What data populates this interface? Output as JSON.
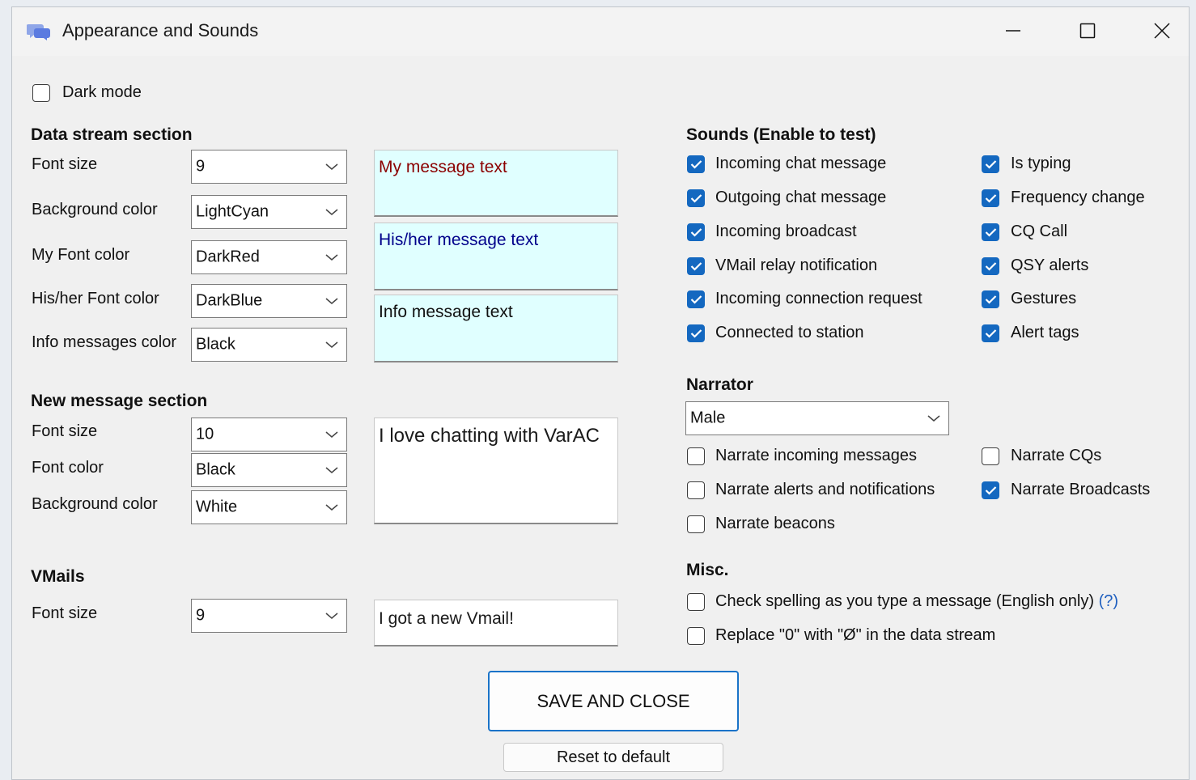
{
  "window": {
    "title": "Appearance and Sounds"
  },
  "dark_mode": {
    "label": "Dark mode",
    "checked": false
  },
  "data_stream": {
    "header": "Data stream section",
    "font_size": {
      "label": "Font size",
      "value": "9"
    },
    "background_color": {
      "label": "Background color",
      "value": "LightCyan"
    },
    "my_font_color": {
      "label": "My Font color",
      "value": "DarkRed"
    },
    "his_font_color": {
      "label": "His/her Font color",
      "value": "DarkBlue"
    },
    "info_color": {
      "label": "Info messages color",
      "value": "Black"
    },
    "preview_my": "My message text",
    "preview_his": "His/her message text",
    "preview_info": "Info message text",
    "colors": {
      "background": "#E0FFFF",
      "my": "#8B0000",
      "his": "#00008B",
      "info": "#000000"
    }
  },
  "new_message": {
    "header": "New message section",
    "font_size": {
      "label": "Font size",
      "value": "10"
    },
    "font_color": {
      "label": "Font color",
      "value": "Black"
    },
    "background_color": {
      "label": "Background color",
      "value": "White"
    },
    "preview": "I love chatting with VarAC"
  },
  "vmails": {
    "header": "VMails",
    "font_size": {
      "label": "Font size",
      "value": "9"
    },
    "preview": "I got a new Vmail!"
  },
  "sounds": {
    "header": "Sounds (Enable to test)",
    "left": [
      {
        "label": "Incoming chat message",
        "checked": true
      },
      {
        "label": "Outgoing chat message",
        "checked": true
      },
      {
        "label": "Incoming broadcast",
        "checked": true
      },
      {
        "label": "VMail relay notification",
        "checked": true
      },
      {
        "label": "Incoming connection request",
        "checked": true
      },
      {
        "label": "Connected to station",
        "checked": true
      }
    ],
    "right": [
      {
        "label": "Is typing",
        "checked": true
      },
      {
        "label": "Frequency change",
        "checked": true
      },
      {
        "label": "CQ Call",
        "checked": true
      },
      {
        "label": "QSY alerts",
        "checked": true
      },
      {
        "label": "Gestures",
        "checked": true
      },
      {
        "label": "Alert tags",
        "checked": true
      }
    ]
  },
  "narrator": {
    "header": "Narrator",
    "voice": "Male",
    "options": {
      "incoming": {
        "label": "Narrate incoming messages",
        "checked": false
      },
      "cqs": {
        "label": "Narrate CQs",
        "checked": false
      },
      "alerts": {
        "label": "Narrate alerts and notifications",
        "checked": false
      },
      "broadcasts": {
        "label": "Narrate Broadcasts",
        "checked": true
      },
      "beacons": {
        "label": "Narrate beacons",
        "checked": false
      }
    }
  },
  "misc": {
    "header": "Misc.",
    "spell": {
      "label": "Check spelling as you type a message (English only)",
      "help": "(?)",
      "checked": false
    },
    "replace_zero": {
      "label": "Replace \"0\" with \"Ø\" in the data stream",
      "checked": false
    }
  },
  "buttons": {
    "save": "SAVE AND CLOSE",
    "reset": "Reset to default"
  },
  "theme": {
    "accent": "#1468C0",
    "window_bg": "#F0F0F0"
  }
}
